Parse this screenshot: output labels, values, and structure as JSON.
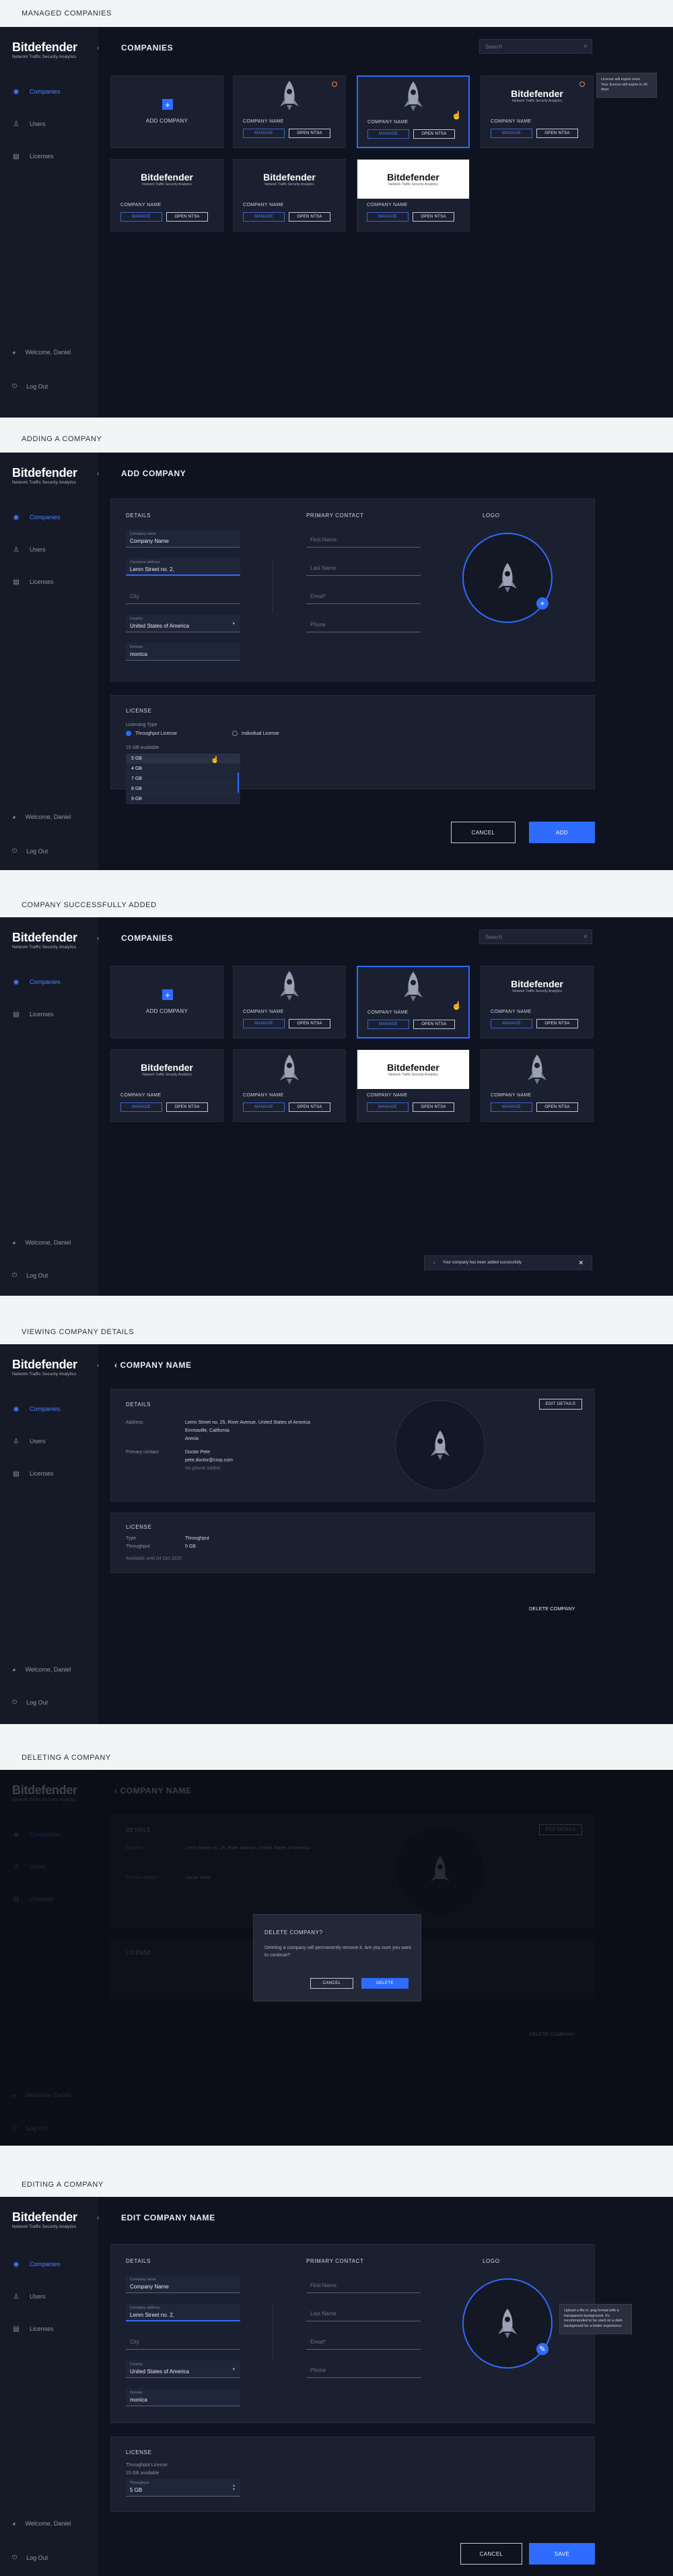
{
  "colors": {
    "accent": "#2f6bff",
    "bg": "#0f1320",
    "sidebar": "#161a27",
    "card": "#1b2030",
    "warning": "#f08a3c"
  },
  "brand": {
    "name": "Bitdefender",
    "tagline": "Network Traffic Security Analytics"
  },
  "sections": {
    "managed": "MANAGED COMPANIES",
    "adding": "ADDING A COMPANY",
    "added": "COMPANY SUCCESSFULLY ADDED",
    "viewing": "VIEWING COMPANY DETAILS",
    "deleting": "DELETING A COMPANY",
    "editing": "EDITING A COMPANY"
  },
  "nav": {
    "companies": "Companies",
    "users": "Users",
    "licenses": "Licenses",
    "welcome": "Welcome, Daniel",
    "logout": "Log Out"
  },
  "nav_icons": {
    "companies": "companies-icon",
    "users": "users-icon",
    "licenses": "licenses-icon",
    "welcome": "user-avatar-icon",
    "logout": "logout-icon"
  },
  "companies_page": {
    "title": "COMPANIES",
    "search_placeholder": "Search",
    "add_label": "ADD COMPANY",
    "card_name": "COMPANY NAME",
    "manage": "MANAGE",
    "open": "OPEN NTSA",
    "tooltip": "License will expire soon\nYour license will expire in 30 days"
  },
  "add_page": {
    "title": "ADD COMPANY",
    "details": "DETAILS",
    "primary_contact": "PRIMARY CONTACT",
    "logo": "LOGO",
    "company_name_label": "Company name",
    "company_name": "Company Name",
    "address_label": "Company address",
    "address": "Lemn Street no. 2,",
    "city": "City",
    "country_label": "Country",
    "country": "United States of America",
    "domain_label": "Domain",
    "domain": "monica",
    "first_name": "First Name",
    "last_name": "Last Name",
    "email": "Email*",
    "phone": "Phone",
    "license": "LICENSE",
    "licensing_type": "Licensing Type",
    "throughput_license": "Throughput License",
    "individual_license": "Individual License",
    "available": "15 GB available",
    "options": [
      "5 GB",
      "4 GB",
      "7 GB",
      "8 GB",
      "9 GB"
    ],
    "cancel": "CANCEL",
    "add": "ADD"
  },
  "toast": {
    "message": "Your company has been added successfully"
  },
  "view_page": {
    "title": "COMPANY NAME",
    "details": "DETAILS",
    "edit": "EDIT DETAILS",
    "address_label": "Address",
    "address_lines": [
      "Lemn Street no. 25, River Avenue, United States of America",
      "Emmaville, California",
      "Arecia"
    ],
    "contact_label": "Primary contact",
    "contact_lines": [
      "Doctor Pete",
      "pete.doctor@corp.com",
      "No phone added"
    ],
    "license": "LICENSE",
    "type_label": "Type",
    "type_value": "Throughput",
    "throughput_label": "Throughput",
    "throughput_value": "5 GB",
    "available_note": "Available until 04 Oct 2020",
    "delete": "DELETE COMPANY"
  },
  "delete_modal": {
    "title": "DELETE COMPANY?",
    "body": "Deleting a company will permanently remove it. Are you sure you want to continue?",
    "cancel": "CANCEL",
    "delete": "DELETE"
  },
  "edit_page": {
    "title": "EDIT COMPANY NAME",
    "throughput_label": "Throughput License",
    "available": "15 GB available",
    "throughput_field_label": "Throughput",
    "throughput_value": "5 GB",
    "cancel": "CANCEL",
    "save": "SAVE",
    "tooltip": "Upload a file in .png format with a transparent background. It's recommended to be used on a dark background for a better experience."
  }
}
